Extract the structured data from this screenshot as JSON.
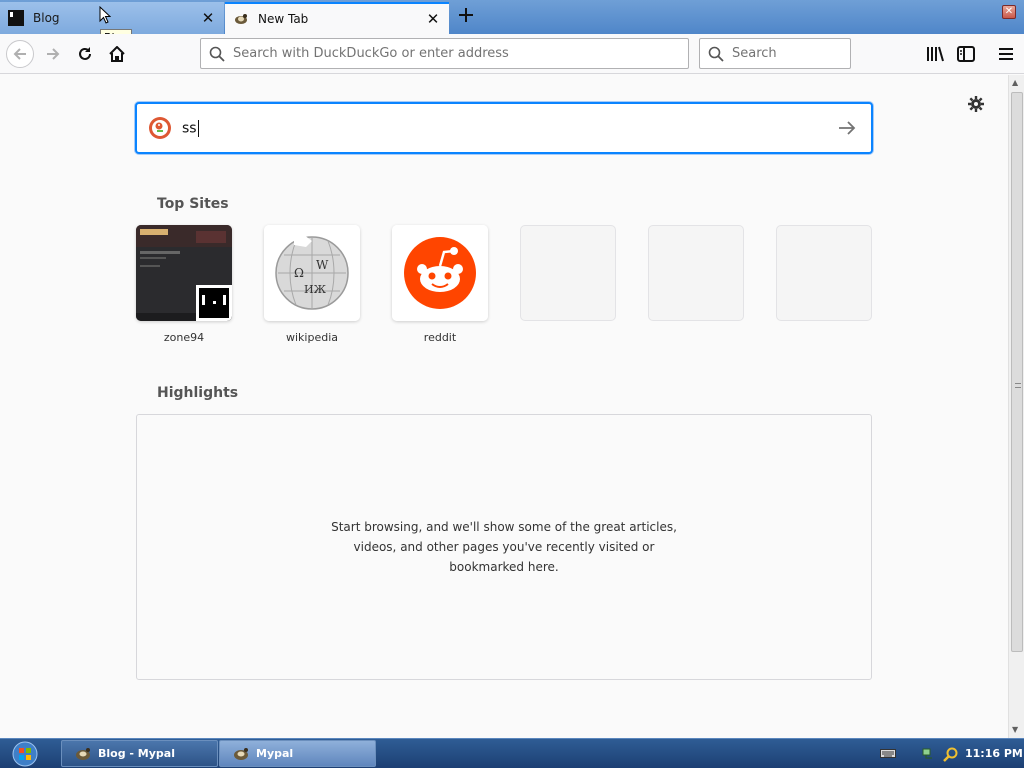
{
  "tabs": [
    {
      "label": "Blog",
      "icon": "blog-favicon",
      "active": false
    },
    {
      "label": "New Tab",
      "icon": "mypal-favicon",
      "active": true
    }
  ],
  "tooltip": "Blog",
  "toolbar": {
    "url_placeholder": "Search with DuckDuckGo or enter address",
    "search_placeholder": "Search"
  },
  "newtab": {
    "search_value": "ss",
    "top_sites_title": "Top Sites",
    "top_sites": [
      {
        "label": "zone94",
        "icon": "zone94-thumbnail"
      },
      {
        "label": "wikipedia",
        "icon": "wikipedia-globe"
      },
      {
        "label": "reddit",
        "icon": "reddit-alien"
      },
      {
        "label": "",
        "icon": ""
      },
      {
        "label": "",
        "icon": ""
      },
      {
        "label": "",
        "icon": ""
      }
    ],
    "highlights_title": "Highlights",
    "highlights_message": "Start browsing, and we'll show some of the great articles, videos, and other pages you've recently visited or bookmarked here."
  },
  "taskbar": {
    "items": [
      {
        "label": "Blog - Mypal",
        "icon": "mypal-icon"
      },
      {
        "label": "Mypal",
        "icon": "mypal-icon"
      }
    ],
    "clock": "11:16 PM"
  },
  "colors": {
    "accent": "#0a84ff",
    "reddit": "#ff4500",
    "taskbar": "#1c3f73"
  }
}
